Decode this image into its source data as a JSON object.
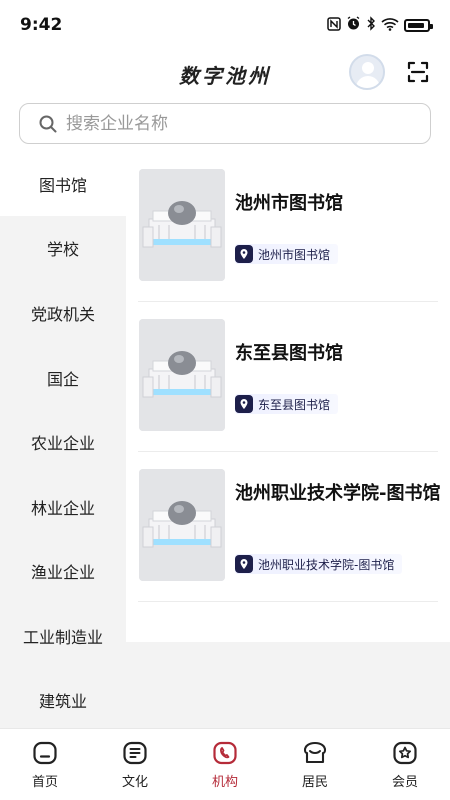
{
  "status_bar": {
    "time": "9:42",
    "icons": [
      "nfc-icon",
      "alarm-icon",
      "bluetooth-icon",
      "wifi-icon",
      "battery-icon"
    ]
  },
  "header": {
    "title": "数字池州"
  },
  "search": {
    "placeholder": "搜索企业名称"
  },
  "sidebar": {
    "items": [
      {
        "label": "图书馆",
        "active": true
      },
      {
        "label": "学校"
      },
      {
        "label": "党政机关"
      },
      {
        "label": "国企"
      },
      {
        "label": "农业企业"
      },
      {
        "label": "林业企业"
      },
      {
        "label": "渔业企业"
      },
      {
        "label": "工业制造业"
      },
      {
        "label": "建筑业"
      }
    ]
  },
  "list": {
    "items": [
      {
        "title": "池州市图书馆",
        "tag": "池州市图书馆"
      },
      {
        "title": "东至县图书馆",
        "tag": "东至县图书馆"
      },
      {
        "title": "池州职业技术学院-图书馆",
        "tag": "池州职业技术学院-图书馆"
      }
    ]
  },
  "tabbar": {
    "tabs": [
      {
        "label": "首页",
        "icon": "home-icon"
      },
      {
        "label": "文化",
        "icon": "culture-icon"
      },
      {
        "label": "机构",
        "icon": "institution-icon",
        "active": true
      },
      {
        "label": "居民",
        "icon": "resident-icon"
      },
      {
        "label": "会员",
        "icon": "member-icon"
      }
    ]
  },
  "colors": {
    "accent": "#b52b39",
    "sidebar_bg": "#f3f3f3",
    "tag_dark": "#1d1f4a"
  }
}
